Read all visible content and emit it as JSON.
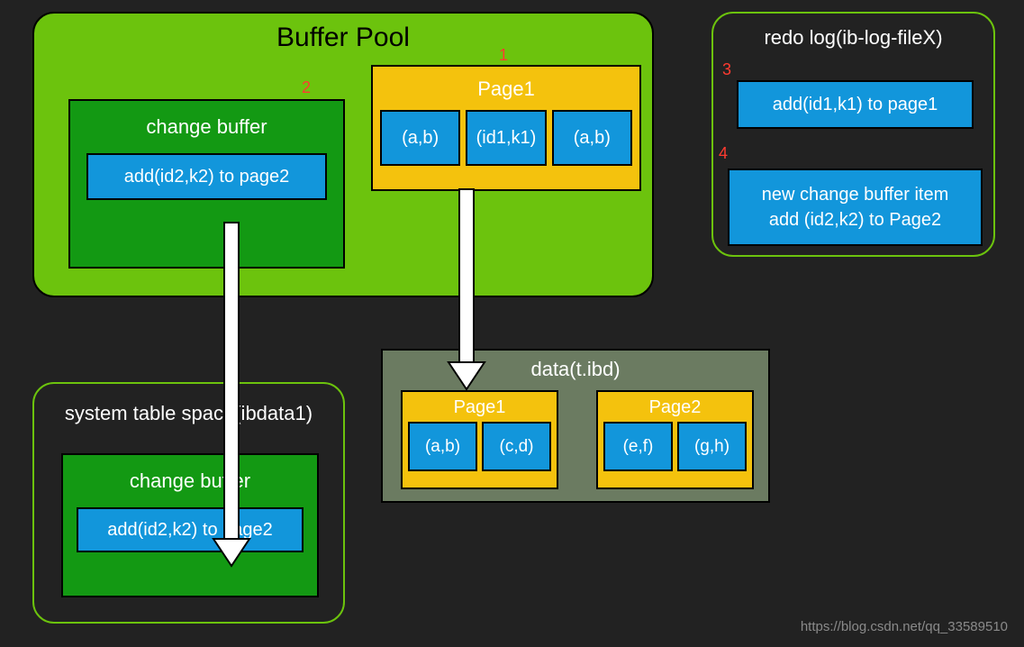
{
  "bufferPool": {
    "title": "Buffer Pool",
    "marker1": "1",
    "marker2": "2",
    "changeBuffer": {
      "title": "change buffer",
      "entry": "add(id2,k2) to page2"
    },
    "page1": {
      "title": "Page1",
      "cells": [
        "(a,b)",
        "(id1,k1)",
        "(a,b)"
      ]
    }
  },
  "redoLog": {
    "title": "redo log(ib-log-fileX)",
    "marker3": "3",
    "marker4": "4",
    "entry1": "add(id1,k1) to page1",
    "entry2a": "new change buffer item",
    "entry2b": "add (id2,k2) to Page2"
  },
  "sysSpace": {
    "title": "system table space(ibdata1)",
    "changeBuffer": {
      "title": "change buffer",
      "entry": "add(id2,k2) to page2"
    }
  },
  "data": {
    "title": "data(t.ibd)",
    "page1": {
      "title": "Page1",
      "cells": [
        "(a,b)",
        "(c,d)"
      ]
    },
    "page2": {
      "title": "Page2",
      "cells": [
        "(e,f)",
        "(g,h)"
      ]
    }
  },
  "credit": "https://blog.csdn.net/qq_33589510"
}
